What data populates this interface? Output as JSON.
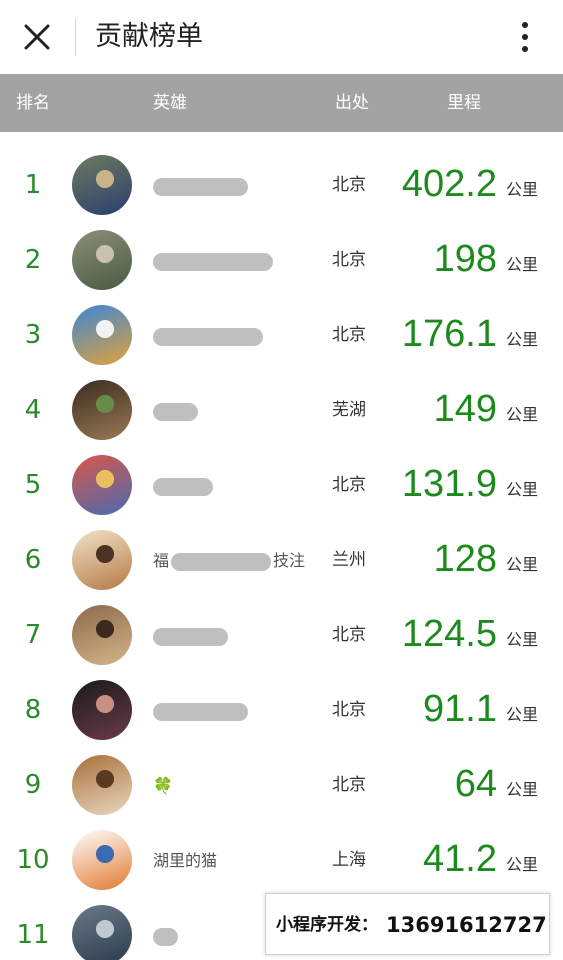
{
  "titlebar": {
    "title": "贡献榜单"
  },
  "table_header": {
    "rank": "排名",
    "hero": "英雄",
    "origin": "出处",
    "distance": "里程"
  },
  "rows": [
    {
      "rank": "1",
      "origin": "北京",
      "distance": "402.2",
      "unit": "公里",
      "name": "",
      "avatar_colors": [
        "#6b7b5e",
        "#2c3e70",
        "#c9b48a"
      ]
    },
    {
      "rank": "2",
      "origin": "北京",
      "distance": "198",
      "unit": "公里",
      "name": "",
      "avatar_colors": [
        "#8a8f7a",
        "#4a5a40",
        "#c8c0b0"
      ]
    },
    {
      "rank": "3",
      "origin": "北京",
      "distance": "176.1",
      "unit": "公里",
      "name": "",
      "avatar_colors": [
        "#3d86d6",
        "#e0a23a",
        "#f2f2f2"
      ]
    },
    {
      "rank": "4",
      "origin": "芜湖",
      "distance": "149",
      "unit": "公里",
      "name": "",
      "avatar_colors": [
        "#3b2b1f",
        "#9a7a55",
        "#6a8a4a"
      ]
    },
    {
      "rank": "5",
      "origin": "北京",
      "distance": "131.9",
      "unit": "公里",
      "name": "",
      "avatar_colors": [
        "#d8584a",
        "#4a6ab0",
        "#e8c060"
      ]
    },
    {
      "rank": "6",
      "origin": "兰州",
      "distance": "128",
      "unit": "公里",
      "name": "福",
      "name_tail": "技注",
      "avatar_colors": [
        "#f3e2c6",
        "#b37a45",
        "#4a3323"
      ]
    },
    {
      "rank": "7",
      "origin": "北京",
      "distance": "124.5",
      "unit": "公里",
      "name": "",
      "avatar_colors": [
        "#8a6a4a",
        "#d6b58a",
        "#3a2a20"
      ]
    },
    {
      "rank": "8",
      "origin": "北京",
      "distance": "91.1",
      "unit": "公里",
      "name": "",
      "avatar_colors": [
        "#1a1a1a",
        "#6a3a4a",
        "#c99080"
      ]
    },
    {
      "rank": "9",
      "origin": "北京",
      "distance": "64",
      "unit": "公里",
      "name": "🍀",
      "avatar_colors": [
        "#a8703a",
        "#e8d8c0",
        "#5a3a20"
      ]
    },
    {
      "rank": "10",
      "origin": "上海",
      "distance": "41.2",
      "unit": "公里",
      "name": "湖里的猫",
      "avatar_colors": [
        "#ffffff",
        "#e07a30",
        "#3a6ab0"
      ]
    },
    {
      "rank": "11",
      "origin": "",
      "distance": "",
      "unit": "",
      "name": "",
      "avatar_colors": [
        "#6a7a8a",
        "#2a3a4a",
        "#c0c8d0"
      ]
    }
  ],
  "promo": {
    "label": "小程序开发：",
    "phone": "13691612727"
  },
  "colors": {
    "header_bg": "#a3a3a3",
    "rank_green": "#2b8a2b",
    "distance_green": "#1d8a1d"
  },
  "icons": {
    "close": "close-icon",
    "more": "more-vertical-icon"
  }
}
